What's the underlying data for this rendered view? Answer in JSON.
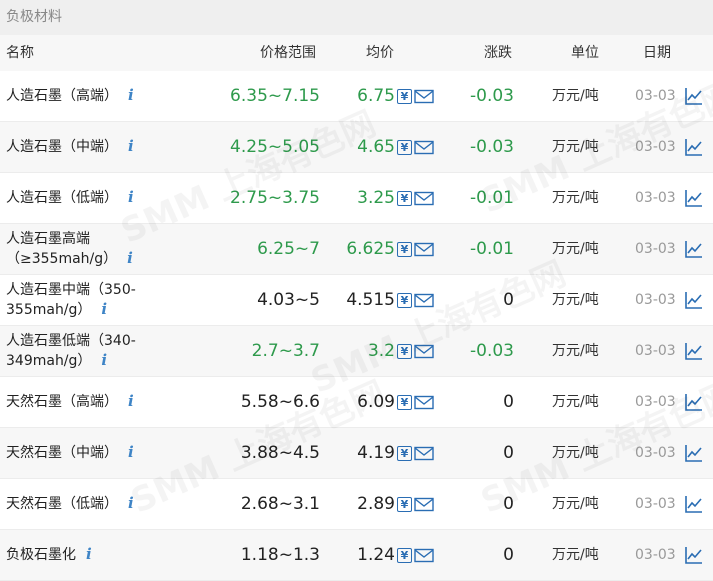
{
  "section_title": "负极材料",
  "columns": {
    "name": "名称",
    "price_range": "价格范围",
    "avg": "均价",
    "change": "涨跌",
    "unit": "单位",
    "date": "日期"
  },
  "rows": [
    {
      "name": "人造石墨（高端）",
      "range": "6.35~7.15",
      "avg": "6.75",
      "change": "-0.03",
      "unit": "万元/吨",
      "date": "03-03",
      "color": "green"
    },
    {
      "name": "人造石墨（中端）",
      "range": "4.25~5.05",
      "avg": "4.65",
      "change": "-0.03",
      "unit": "万元/吨",
      "date": "03-03",
      "color": "green"
    },
    {
      "name": "人造石墨（低端）",
      "range": "2.75~3.75",
      "avg": "3.25",
      "change": "-0.01",
      "unit": "万元/吨",
      "date": "03-03",
      "color": "green"
    },
    {
      "name": "人造石墨高端（≥355mah/g）",
      "range": "6.25~7",
      "avg": "6.625",
      "change": "-0.01",
      "unit": "万元/吨",
      "date": "03-03",
      "color": "green"
    },
    {
      "name": "人造石墨中端（350-355mah/g）",
      "range": "4.03~5",
      "avg": "4.515",
      "change": "0",
      "unit": "万元/吨",
      "date": "03-03",
      "color": "black"
    },
    {
      "name": "人造石墨低端（340-349mah/g）",
      "range": "2.7~3.7",
      "avg": "3.2",
      "change": "-0.03",
      "unit": "万元/吨",
      "date": "03-03",
      "color": "green"
    },
    {
      "name": "天然石墨（高端）",
      "range": "5.58~6.6",
      "avg": "6.09",
      "change": "0",
      "unit": "万元/吨",
      "date": "03-03",
      "color": "black"
    },
    {
      "name": "天然石墨（中端）",
      "range": "3.88~4.5",
      "avg": "4.19",
      "change": "0",
      "unit": "万元/吨",
      "date": "03-03",
      "color": "black"
    },
    {
      "name": "天然石墨（低端）",
      "range": "2.68~3.1",
      "avg": "2.89",
      "change": "0",
      "unit": "万元/吨",
      "date": "03-03",
      "color": "black"
    },
    {
      "name": "负极石墨化",
      "range": "1.18~1.3",
      "avg": "1.24",
      "change": "0",
      "unit": "万元/吨",
      "date": "03-03",
      "color": "black"
    }
  ],
  "icons": {
    "info": "info-icon",
    "price": "yen-icon",
    "mail": "mail-icon",
    "trend": "line-chart-icon"
  },
  "watermark": {
    "brand": "SMM",
    "text": "上海有色网"
  },
  "colors": {
    "down": "#2e9a4c",
    "neutral": "#222222",
    "icon": "#2a6db3",
    "info": "#3e84c6"
  }
}
